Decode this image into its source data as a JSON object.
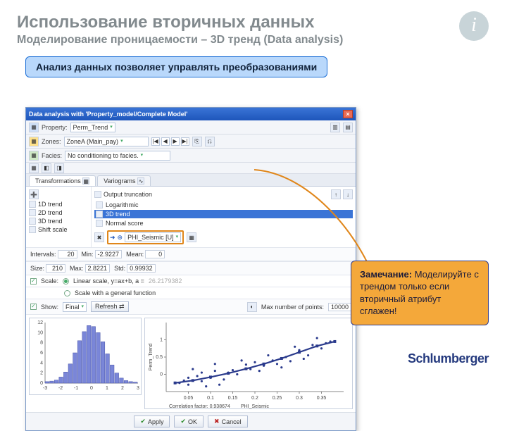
{
  "slide": {
    "title": "Использование вторичных данных",
    "subtitle": "Моделирование проницаемости – 3D тренд (Data analysis)",
    "callout_blue": "Анализ данных позволяет управлять преобразованиями",
    "callout_orange_bold": "Замечание:",
    "callout_orange_text": " Моделируйте с трендом только если вторичный атрибут сглажен!",
    "brand": "Schlumberger",
    "logo_letter": "i"
  },
  "app": {
    "title": "Data analysis with 'Property_model/Complete Model'",
    "close": "×",
    "property_label": "Property:",
    "property_value": "Perm_Trend",
    "zones_label": "Zones:",
    "zones_value": "ZoneA (Main_pay)",
    "facies_label": "Facies:",
    "facies_value": "No conditioning to facies.",
    "nav_first": "|◀",
    "nav_prev": "◀",
    "nav_next": "▶",
    "nav_last": "▶|",
    "tabs": {
      "transformations": "Transformations",
      "variograms": "Variograms"
    },
    "left_items": [
      "1D trend",
      "2D trend",
      "3D trend",
      "Shift scale"
    ],
    "output_truncation": "Output truncation",
    "options": [
      "Logarithmic",
      "3D trend",
      "Normal score"
    ],
    "sel_option": "3D trend",
    "trend_attr": "PHI_Seismic [U]",
    "stats": {
      "intervals_lbl": "Intervals:",
      "intervals": "20",
      "min_lbl": "Min:",
      "min": "-2.9227",
      "mean_lbl": "Mean:",
      "mean": "0",
      "size_lbl": "Size:",
      "size": "210",
      "max_lbl": "Max:",
      "max": "2.8221",
      "std_lbl": "Std:",
      "std": "0.99932",
      "show_lbl": "Show:",
      "show_value": "Final",
      "refresh": "Refresh ⇄"
    },
    "scale": {
      "label": "Scale:",
      "linear": "Linear scale, y=ax+b, a =",
      "a_value": "26.2179382",
      "general": "Scale with a general function",
      "maxpts_lbl": "Max number of points:",
      "maxpts": "10000"
    },
    "scatter": {
      "xlabel": "PHI_Seismic",
      "ylabel": "Perm_Trend",
      "corr": "Correlation factor: 0.938674"
    },
    "buttons": {
      "apply": "Apply",
      "ok": "OK",
      "cancel": "Cancel"
    }
  },
  "chart_data": [
    {
      "type": "bar",
      "title": "",
      "xlabel": "",
      "ylabel": "",
      "xlim": [
        -3,
        3
      ],
      "ylim": [
        0,
        12
      ],
      "xticks": [
        -3,
        -2,
        -1,
        0,
        1,
        2,
        3
      ],
      "categories": [
        -2.8,
        -2.5,
        -2.2,
        -1.9,
        -1.6,
        -1.3,
        -1.0,
        -0.7,
        -0.4,
        -0.1,
        0.2,
        0.5,
        0.8,
        1.1,
        1.4,
        1.7,
        2.0,
        2.3,
        2.6,
        2.9
      ],
      "values": [
        0.3,
        0.4,
        0.6,
        1.2,
        2.2,
        3.8,
        6.0,
        8.4,
        10.2,
        11.4,
        11.2,
        10.0,
        8.2,
        5.8,
        3.6,
        2.0,
        1.0,
        0.5,
        0.3,
        0.2
      ]
    },
    {
      "type": "scatter",
      "title": "",
      "xlabel": "PHI_Seismic",
      "ylabel": "Perm_Trend",
      "xlim": [
        0,
        0.4
      ],
      "ylim": [
        -0.5,
        1.5
      ],
      "xticks": [
        0.05,
        0.1,
        0.15,
        0.2,
        0.25,
        0.3,
        0.35
      ],
      "yticks": [
        0,
        0.5,
        1
      ],
      "series": [
        {
          "name": "points",
          "x": [
            0.03,
            0.04,
            0.05,
            0.05,
            0.07,
            0.08,
            0.08,
            0.1,
            0.11,
            0.12,
            0.14,
            0.15,
            0.16,
            0.18,
            0.19,
            0.2,
            0.22,
            0.24,
            0.25,
            0.27,
            0.28,
            0.3,
            0.32,
            0.33,
            0.35,
            0.36,
            0.37,
            0.06,
            0.09,
            0.11,
            0.13,
            0.17,
            0.21,
            0.23,
            0.26,
            0.29,
            0.31,
            0.34
          ],
          "y": [
            -0.25,
            -0.18,
            -0.1,
            -0.3,
            -0.05,
            -0.2,
            0.05,
            -0.1,
            0.1,
            -0.3,
            0.05,
            0.12,
            0.0,
            0.28,
            0.15,
            0.35,
            0.25,
            0.4,
            0.3,
            0.5,
            0.38,
            0.7,
            0.55,
            0.85,
            0.75,
            0.9,
            0.95,
            0.15,
            -0.35,
            0.3,
            -0.15,
            0.4,
            0.1,
            0.55,
            0.2,
            0.8,
            0.45,
            1.05
          ]
        },
        {
          "name": "fit",
          "x": [
            0.02,
            0.06,
            0.1,
            0.14,
            0.18,
            0.22,
            0.26,
            0.3,
            0.34,
            0.38
          ],
          "y": [
            -0.25,
            -0.18,
            -0.08,
            0.03,
            0.16,
            0.3,
            0.46,
            0.64,
            0.82,
            0.95
          ]
        }
      ],
      "footer": "Correlation factor: 0.938674"
    }
  ]
}
